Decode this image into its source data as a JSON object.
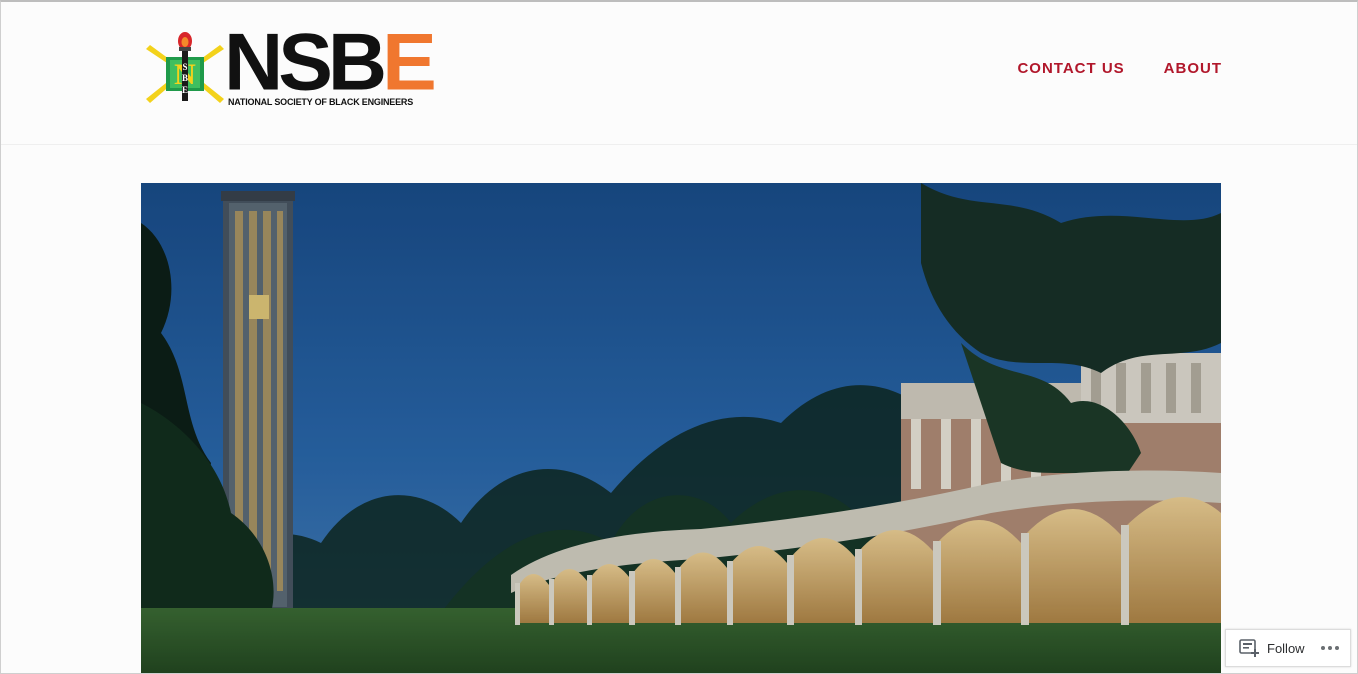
{
  "header": {
    "logo": {
      "wordmark_prefix": "NSB",
      "wordmark_suffix": "E",
      "subtitle": "NATIONAL SOCIETY OF BLACK ENGINEERS",
      "emblem_letters": [
        "N",
        "S",
        "B",
        "E"
      ]
    },
    "nav": {
      "items": [
        {
          "label": "CONTACT US"
        },
        {
          "label": "ABOUT"
        }
      ]
    }
  },
  "hero": {
    "icon": "campus-photo"
  },
  "follow_widget": {
    "label": "Follow",
    "icon": "reader-follow-icon",
    "more_icon": "ellipsis-icon"
  },
  "colors": {
    "nav_link": "#b1172b",
    "logo_accent": "#f0772f",
    "logo_green": "#1f9a4a",
    "logo_yellow": "#f3d21b"
  }
}
